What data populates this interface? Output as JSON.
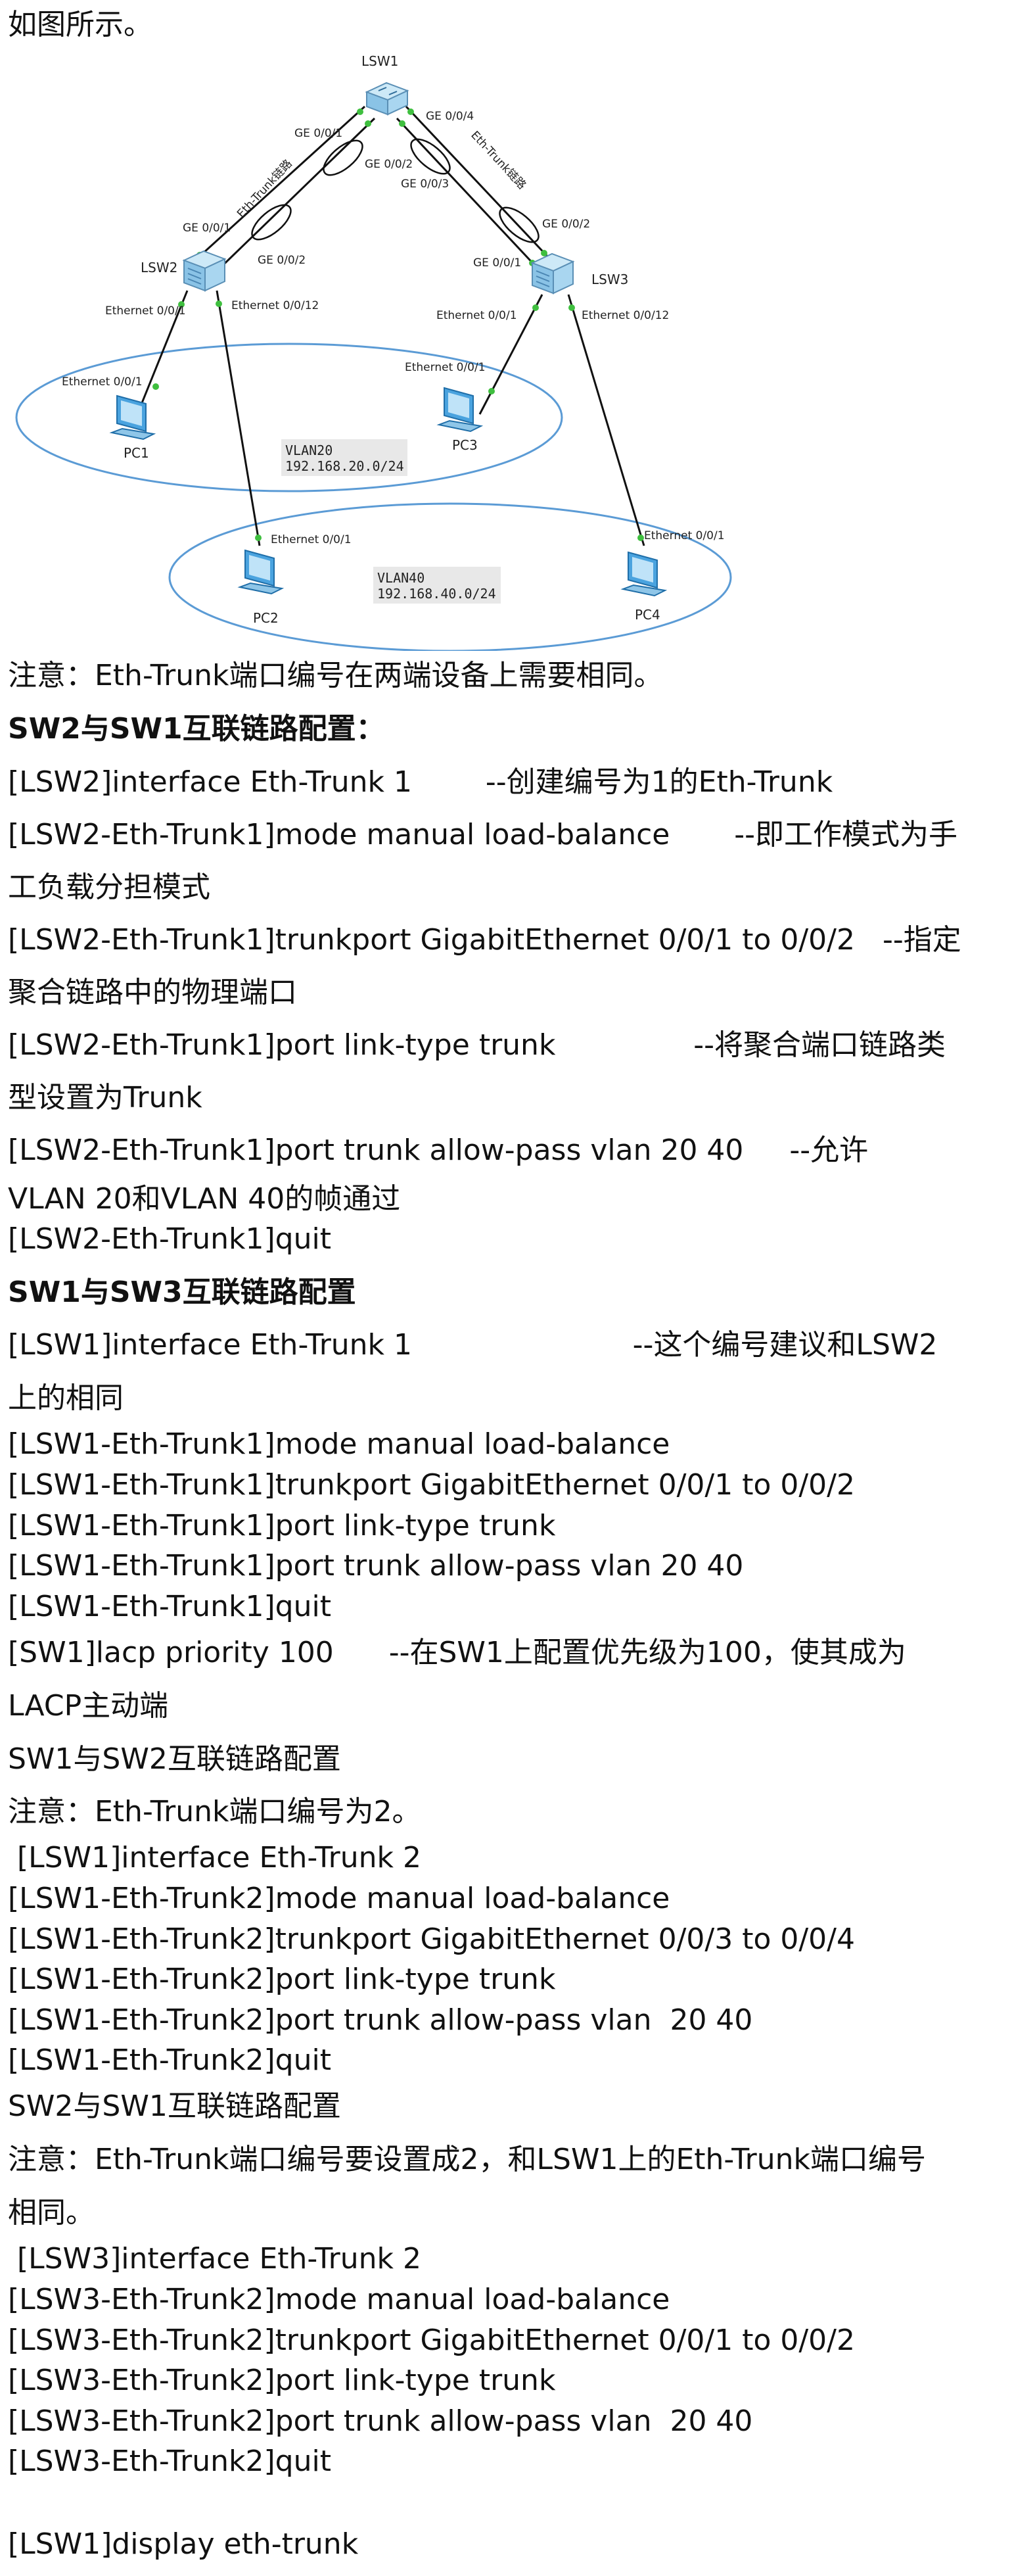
{
  "intro": "如图所示。",
  "diagram": {
    "lsw1": "LSW1",
    "lsw2": "LSW2",
    "lsw3": "LSW3",
    "pc1": "PC1",
    "pc2": "PC2",
    "pc3": "PC3",
    "pc4": "PC4",
    "port_lsw1_ge001": "GE 0/0/1",
    "port_lsw1_ge002": "GE 0/0/2",
    "port_lsw1_ge003": "GE 0/0/3",
    "port_lsw1_ge004": "GE 0/0/4",
    "port_lsw2_ge001": "GE 0/0/1",
    "port_lsw2_ge002": "GE 0/0/2",
    "port_lsw3_ge001": "GE 0/0/1",
    "port_lsw3_ge002": "GE 0/0/2",
    "eth_trunk_left": "Eth-Trunk链路",
    "eth_trunk_right": "Eth-Trunk链路",
    "lsw2_eth001": "Ethernet 0/0/1",
    "lsw2_eth0012": "Ethernet 0/0/12",
    "lsw3_eth001": "Ethernet 0/0/1",
    "lsw3_eth0012": "Ethernet 0/0/12",
    "pc1_eth": "Ethernet 0/0/1",
    "pc2_eth": "Ethernet 0/0/1",
    "pc3_eth": "Ethernet 0/0/1",
    "pc4_eth": "Ethernet 0/0/1",
    "vlan20_name": "VLAN20",
    "vlan20_net": "192.168.20.0/24",
    "vlan40_name": "VLAN40",
    "vlan40_net": "192.168.40.0/24"
  },
  "lines": [
    "注意：Eth-Trunk端口编号在两端设备上需要相同。",
    "SW2与SW1互联链路配置：",
    "[LSW2]interface Eth-Trunk 1        --创建编号为1的Eth-Trunk",
    "[LSW2-Eth-Trunk1]mode manual load-balance       --即工作模式为手",
    "工负载分担模式",
    "[LSW2-Eth-Trunk1]trunkport GigabitEthernet 0/0/1 to 0/0/2   --指定",
    "聚合链路中的物理端口",
    "[LSW2-Eth-Trunk1]port link-type trunk               --将聚合端口链路类",
    "型设置为Trunk",
    "[LSW2-Eth-Trunk1]port trunk allow-pass vlan 20 40     --允许",
    "VLAN 20和VLAN 40的帧通过",
    "[LSW2-Eth-Trunk1]quit",
    "SW1与SW3互联链路配置",
    "[LSW1]interface Eth-Trunk 1                        --这个编号建议和LSW2",
    "上的相同",
    "[LSW1-Eth-Trunk1]mode manual load-balance",
    "[LSW1-Eth-Trunk1]trunkport GigabitEthernet 0/0/1 to 0/0/2",
    "[LSW1-Eth-Trunk1]port link-type trunk",
    "[LSW1-Eth-Trunk1]port trunk allow-pass vlan 20 40",
    "[LSW1-Eth-Trunk1]quit",
    "[SW1]lacp priority 100      --在SW1上配置优先级为100，使其成为",
    "LACP主动端",
    "SW1与SW2互联链路配置",
    "注意：Eth-Trunk端口编号为2。",
    " [LSW1]interface Eth-Trunk 2",
    "[LSW1-Eth-Trunk2]mode manual load-balance",
    "[LSW1-Eth-Trunk2]trunkport GigabitEthernet 0/0/3 to 0/0/4",
    "[LSW1-Eth-Trunk2]port link-type trunk",
    "[LSW1-Eth-Trunk2]port trunk allow-pass vlan  20 40",
    "[LSW1-Eth-Trunk2]quit",
    "SW2与SW1互联链路配置",
    "注意：Eth-Trunk端口编号要设置成2，和LSW1上的Eth-Trunk端口编号",
    "相同。",
    " [LSW3]interface Eth-Trunk 2",
    "[LSW3-Eth-Trunk2]mode manual load-balance",
    "[LSW3-Eth-Trunk2]trunkport GigabitEthernet 0/0/1 to 0/0/2",
    "[LSW3-Eth-Trunk2]port link-type trunk",
    "[LSW3-Eth-Trunk2]port trunk allow-pass vlan  20 40",
    "[LSW3-Eth-Trunk2]quit",
    "[LSW1]display eth-trunk"
  ]
}
